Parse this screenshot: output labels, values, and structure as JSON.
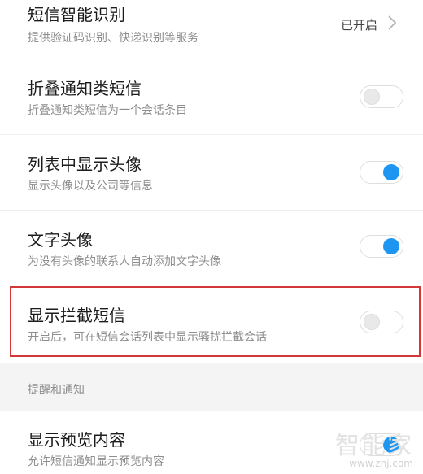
{
  "settings": [
    {
      "title": "短信智能识别",
      "subtitle": "提供验证码识别、快递识别等服务",
      "status": "已开启"
    },
    {
      "title": "折叠通知类短信",
      "subtitle": "折叠通知类短信为一个会话条目",
      "toggle": "off"
    },
    {
      "title": "列表中显示头像",
      "subtitle": "显示头像以及公司等信息",
      "toggle": "on"
    },
    {
      "title": "文字头像",
      "subtitle": "为没有头像的联系人自动添加文字头像",
      "toggle": "on"
    },
    {
      "title": "显示拦截短信",
      "subtitle": "开启后，可在短信会话列表中显示骚扰拦截会话",
      "toggle": "off"
    },
    {
      "title": "显示预览内容",
      "subtitle": "允许短信通知显示预览内容",
      "toggle": "on"
    }
  ],
  "section": {
    "label": "提醒和通知"
  },
  "watermark": {
    "text": "智能家",
    "url": "www.znj.com"
  },
  "colors": {
    "accent": "#1e95f0",
    "highlight": "#d2373a"
  },
  "icons": {
    "chevron": "chevron-right-icon"
  }
}
